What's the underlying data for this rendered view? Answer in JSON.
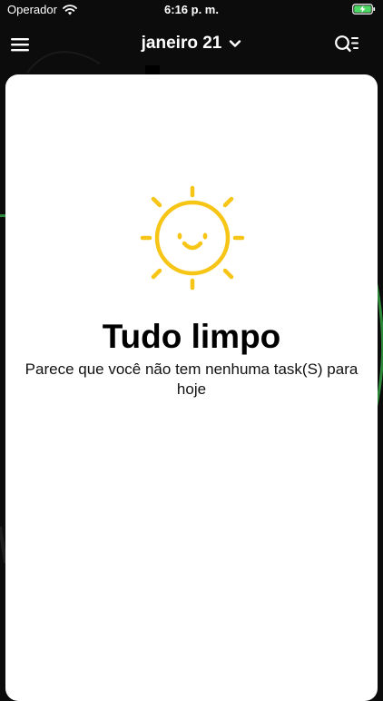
{
  "status_bar": {
    "carrier": "Operador",
    "time": "6:16 p. m."
  },
  "header": {
    "date_label": "janeiro 21"
  },
  "empty_state": {
    "title": "Tudo limpo",
    "subtitle": "Parece que você não tem nenhuma task(S) para hoje"
  },
  "colors": {
    "background": "#0c0c0c",
    "card": "#ffffff",
    "sun": "#f6c516",
    "battery": "#4cd964"
  },
  "icons": {
    "menu": "hamburger-menu-icon",
    "chevron": "chevron-down-icon",
    "search": "search-list-icon",
    "wifi": "wifi-icon",
    "battery": "battery-charging-icon",
    "illustration": "smiling-sun-icon"
  }
}
